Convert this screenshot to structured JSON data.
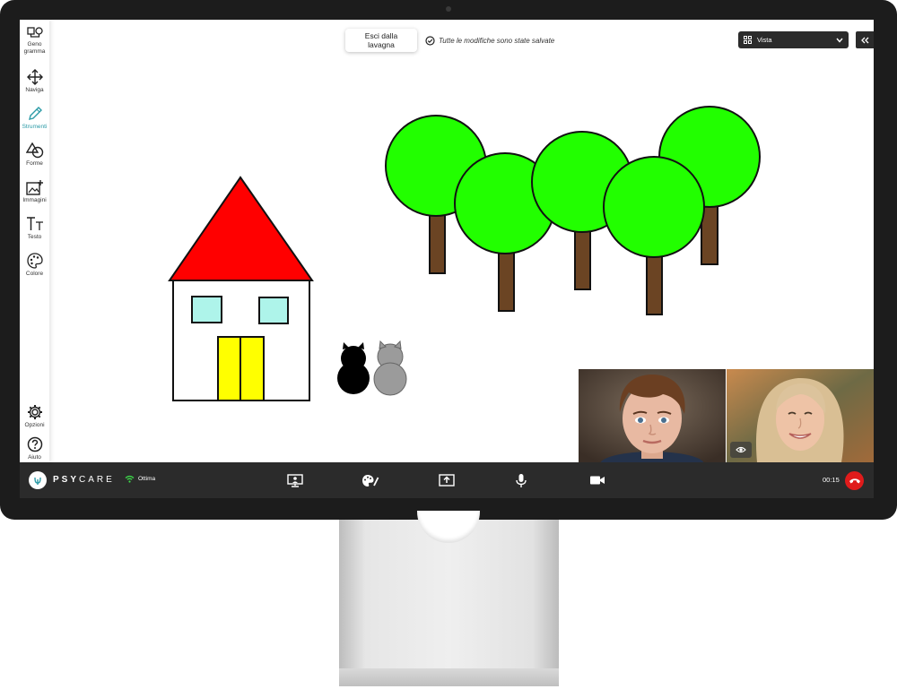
{
  "sidebar": {
    "items": [
      {
        "line1": "Geno",
        "line2": "gramma",
        "icon": "genogram-icon"
      },
      {
        "label": "Naviga",
        "icon": "move-arrows-icon"
      },
      {
        "label": "Strumenti",
        "icon": "pencil-icon",
        "active": true
      },
      {
        "label": "Forme",
        "icon": "shapes-icon"
      },
      {
        "label": "Immagini",
        "icon": "add-image-icon"
      },
      {
        "label": "Testo",
        "icon": "text-icon"
      },
      {
        "label": "Colore",
        "icon": "palette-icon"
      }
    ],
    "bottom_items": [
      {
        "label": "Opzioni",
        "icon": "gear-icon"
      },
      {
        "label": "Aiuto",
        "icon": "help-icon"
      }
    ]
  },
  "toolbar": {
    "exit_label": "Esci dalla lavagna",
    "saved_status": "Tutte le modifiche sono state salvate",
    "view_label": "Vista"
  },
  "bottombar": {
    "brand_bold": "PSY",
    "brand_rest": "CARE",
    "connection": "Ottima",
    "timer": "00:15"
  },
  "colors": {
    "roof": "#ff0000",
    "door": "#ffff00",
    "window": "#aef4ea",
    "tree_crown": "#22ff00",
    "trunk": "#6b4423",
    "accent": "#2a9aa6",
    "hangup": "#e01b1b"
  }
}
